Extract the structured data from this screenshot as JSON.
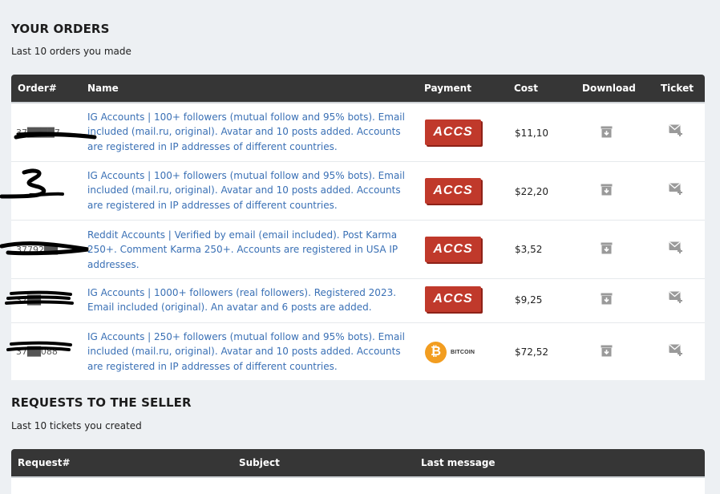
{
  "orders": {
    "title": "YOUR ORDERS",
    "subtitle": "Last 10 orders you made",
    "columns": {
      "order": "Order#",
      "name": "Name",
      "payment": "Payment",
      "cost": "Cost",
      "download": "Download",
      "ticket": "Ticket"
    },
    "rows": [
      {
        "order": "37████7",
        "name": "IG Accounts | 100+ followers (mutual follow and 95% bots). Email included (mail.ru, original). Avatar and 10 posts added. Accounts are registered in IP addresses of different countries.",
        "payment": "ACCS",
        "cost": "$11,10"
      },
      {
        "order": "",
        "name": "IG Accounts | 100+ followers (mutual follow and 95% bots). Email included (mail.ru, original). Avatar and 10 posts added. Accounts are registered in IP addresses of different countries.",
        "payment": "ACCS",
        "cost": "$22,20"
      },
      {
        "order": "37792██",
        "name": "Reddit Accounts | Verified by email (email included). Post Karma 250+. Comment Karma 250+. Accounts are registered in USA IP addresses.",
        "payment": "ACCS",
        "cost": "$3,52"
      },
      {
        "order": "37██",
        "name": "IG Accounts | 1000+ followers (real followers). Registered 2023. Email included (original). An avatar and 6 posts are added.",
        "payment": "ACCS",
        "cost": "$9,25"
      },
      {
        "order": "37██088",
        "name": "IG Accounts | 250+ followers (mutual follow and 95% bots). Email included (mail.ru, original). Avatar and 10 posts added. Accounts are registered in IP addresses of different countries.",
        "payment": "BITCOIN",
        "cost": "$72,52"
      }
    ]
  },
  "requests": {
    "title": "REQUESTS TO THE SELLER",
    "subtitle": "Last 10 tickets you created",
    "columns": {
      "request": "Request#",
      "subject": "Subject",
      "last_message": "Last message"
    }
  },
  "icons": {
    "download": "download-box-icon",
    "ticket": "mail-plus-icon",
    "bitcoin": "bitcoin-logo"
  },
  "colors": {
    "header_bg": "#363636",
    "link": "#3a70b5",
    "accs_red": "#c0392b",
    "bitcoin_orange": "#f29d20",
    "page_bg": "#edf0f3"
  }
}
